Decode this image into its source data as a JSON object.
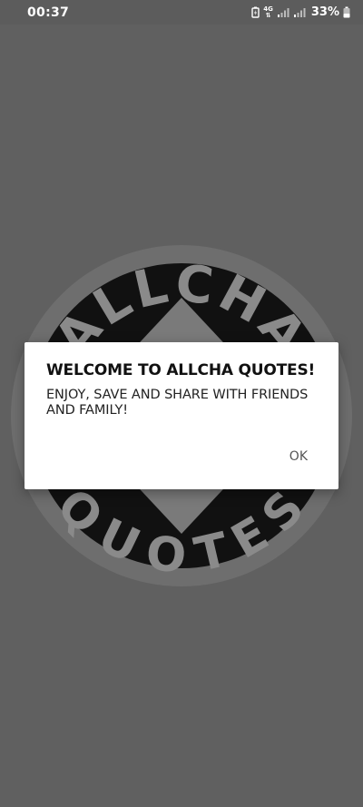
{
  "status_bar": {
    "time": "00:37",
    "network": "4G",
    "battery": "33%"
  },
  "logo": {
    "top_text": "ALLCHA",
    "bottom_text": "QUOTES"
  },
  "dialog": {
    "title": "WELCOME TO ALLCHA QUOTES!",
    "message": "ENJOY, SAVE AND SHARE WITH FRIENDS AND FAMILY!",
    "ok_label": "OK"
  },
  "colors": {
    "background": "#606060",
    "logo_ring": "#6e6e6e",
    "logo_disc": "#111111",
    "logo_text": "#8a8a8a",
    "dialog_bg": "#ffffff"
  }
}
